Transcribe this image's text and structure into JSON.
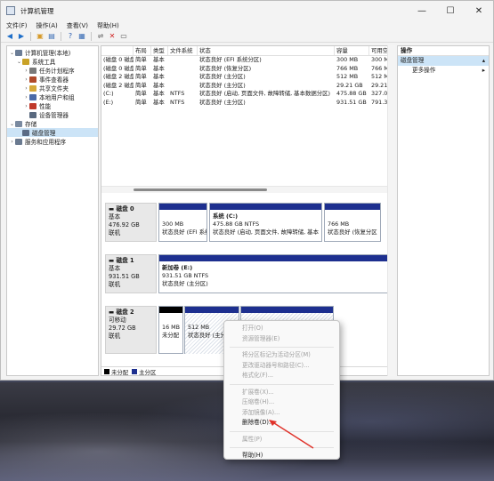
{
  "window": {
    "title": "计算机管理"
  },
  "menu": [
    "文件(F)",
    "操作(A)",
    "查看(V)",
    "帮助(H)"
  ],
  "tree": [
    {
      "label": "计算机管理(本地)",
      "level": 0,
      "twisty": "v",
      "icon": "computer-icon",
      "color": "#6b7d96"
    },
    {
      "label": "系统工具",
      "level": 1,
      "twisty": "v",
      "icon": "tools-icon",
      "color": "#c9a227"
    },
    {
      "label": "任务计划程序",
      "level": 2,
      "twisty": ">",
      "icon": "clock-icon",
      "color": "#7a7a7a"
    },
    {
      "label": "事件查看器",
      "level": 2,
      "twisty": ">",
      "icon": "event-viewer-icon",
      "color": "#b04a2a"
    },
    {
      "label": "共享文件夹",
      "level": 2,
      "twisty": ">",
      "icon": "folder-icon",
      "color": "#d6a93a"
    },
    {
      "label": "本地用户和组",
      "level": 2,
      "twisty": ">",
      "icon": "users-icon",
      "color": "#4a6aa8"
    },
    {
      "label": "性能",
      "level": 2,
      "twisty": ">",
      "icon": "performance-icon",
      "color": "#c0392b"
    },
    {
      "label": "设备管理器",
      "level": 2,
      "twisty": "",
      "icon": "device-manager-icon",
      "color": "#5a6a80"
    },
    {
      "label": "存储",
      "level": 0,
      "twisty": "v",
      "icon": "storage-icon",
      "color": "#7a8aa0"
    },
    {
      "label": "磁盘管理",
      "level": 1,
      "twisty": "",
      "icon": "disk-icon",
      "color": "#5b6b85",
      "selected": true
    },
    {
      "label": "服务和应用程序",
      "level": 0,
      "twisty": ">",
      "icon": "services-icon",
      "color": "#6a7a90"
    }
  ],
  "volumes": {
    "headers": [
      "",
      "布局",
      "类型",
      "文件系统",
      "状态",
      "容量",
      "可用空间"
    ],
    "rows": [
      [
        "(磁盘 0 磁盘分区 1)",
        "简单",
        "基本",
        "",
        "状态良好 (EFI 系统分区)",
        "300 MB",
        "300 MB"
      ],
      [
        "(磁盘 0 磁盘分区 4)",
        "简单",
        "基本",
        "",
        "状态良好 (恢复分区)",
        "766 MB",
        "766 MB"
      ],
      [
        "(磁盘 2 磁盘分区 1)",
        "简单",
        "基本",
        "",
        "状态良好 (主分区)",
        "512 MB",
        "512 MB"
      ],
      [
        "(磁盘 2 磁盘分区 2)",
        "简单",
        "基本",
        "",
        "状态良好 (主分区)",
        "29.21 GB",
        "29.21 GB"
      ],
      [
        "(C:)",
        "简单",
        "基本",
        "NTFS",
        "状态良好 (启动, 页面文件, 故障转储, 基本数据分区)",
        "475.88 GB",
        "327.09 GB"
      ],
      [
        "(E:)",
        "简单",
        "基本",
        "NTFS",
        "状态良好 (主分区)",
        "931.51 GB",
        "791.37 GB"
      ]
    ]
  },
  "disks": {
    "disk0": {
      "name": "磁盘 0",
      "type": "基本",
      "size": "476.92 GB",
      "status": "联机",
      "p1": {
        "line1": "300 MB",
        "line2": "状态良好 (EFI 系统"
      },
      "p2": {
        "name": "系统 (C:)",
        "line1": "475.88 GB NTFS",
        "line2": "状态良好 (启动, 页面文件, 故障转储, 基本"
      },
      "p3": {
        "line1": "766 MB",
        "line2": "状态良好 (恢复分区"
      }
    },
    "disk1": {
      "name": "磁盘 1",
      "type": "基本",
      "size": "931.51 GB",
      "status": "联机",
      "p1": {
        "name": "新加卷 (E:)",
        "line1": "931.51 GB NTFS",
        "line2": "状态良好 (主分区)"
      }
    },
    "disk2": {
      "name": "磁盘 2",
      "type": "可移动",
      "size": "29.72 GB",
      "status": "联机",
      "p1": {
        "line1": "16 MB",
        "line2": "未分配"
      },
      "p2": {
        "line1": "512 MB",
        "line2": "状态良好 (主分"
      },
      "p3": {
        "line1": "",
        "line2": ""
      }
    }
  },
  "legend": {
    "unallocated": "未分配",
    "primary": "主分区",
    "unallocated_color": "#000000",
    "primary_color": "#1d2f8f"
  },
  "actions": {
    "header": "操作",
    "selected": "磁盘管理",
    "more": "更多操作"
  },
  "context_menu": [
    {
      "label": "打开(O)",
      "enabled": false
    },
    {
      "label": "资源管理器(E)",
      "enabled": false
    },
    {
      "sep": true
    },
    {
      "label": "将分区标记为活动分区(M)",
      "enabled": false
    },
    {
      "label": "更改驱动器号和路径(C)...",
      "enabled": false
    },
    {
      "label": "格式化(F)...",
      "enabled": false
    },
    {
      "sep": true
    },
    {
      "label": "扩展卷(X)...",
      "enabled": false
    },
    {
      "label": "压缩卷(H)...",
      "enabled": false
    },
    {
      "label": "添加镜像(A)...",
      "enabled": false
    },
    {
      "label": "删除卷(D)...",
      "enabled": true
    },
    {
      "sep": true
    },
    {
      "label": "属性(P)",
      "enabled": false
    },
    {
      "sep": true
    },
    {
      "label": "帮助(H)",
      "enabled": true
    }
  ],
  "annotation_color": "#e0322a"
}
